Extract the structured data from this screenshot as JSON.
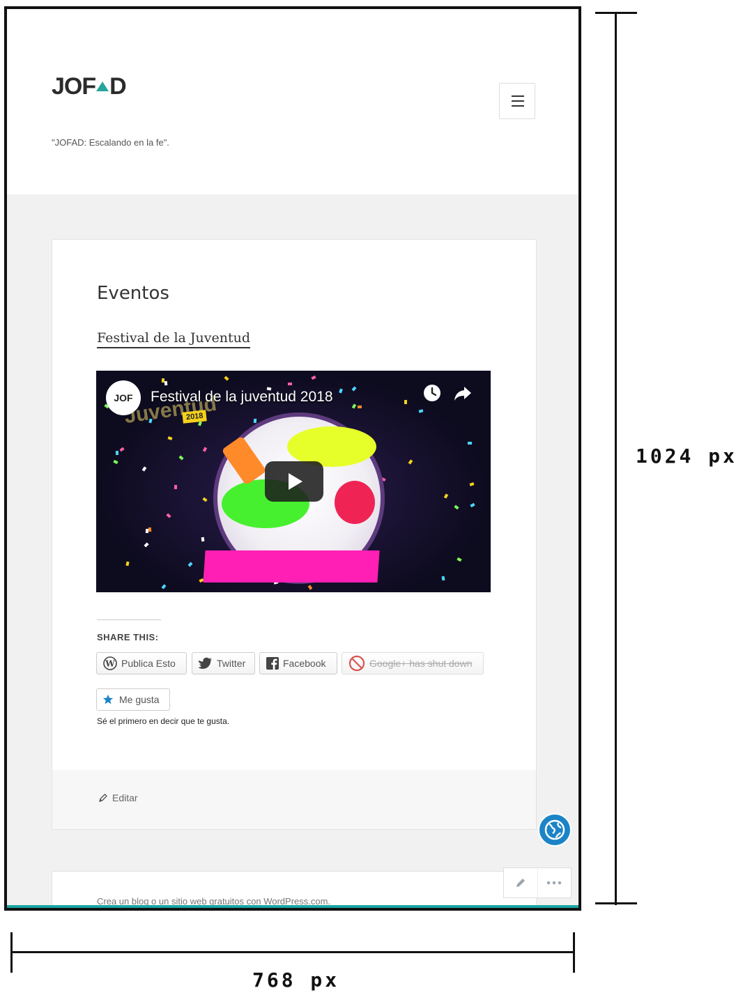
{
  "site": {
    "logo": "JOF",
    "logo_end": "D",
    "tagline": "\"JOFAD: Escalando en la fe\"."
  },
  "post": {
    "title": "Eventos",
    "link_text": "Festival de la Juventud"
  },
  "video": {
    "title": "Festival de la juventud 2018",
    "channel_avatar": "JOF",
    "overlay_text": "Juventud",
    "overlay_year": "2018"
  },
  "sharing": {
    "heading": "SHARE THIS:",
    "buttons": [
      {
        "label": "Publica Esto",
        "icon": "wordpress-icon"
      },
      {
        "label": "Twitter",
        "icon": "twitter-icon"
      },
      {
        "label": "Facebook",
        "icon": "facebook-icon"
      },
      {
        "label": "Google+ has shut down",
        "icon": "prohibited-icon"
      }
    ],
    "like_label": "Me gusta",
    "like_note": "Sé el primero en decir que te gusta."
  },
  "footer": {
    "edit_label": "Editar",
    "credit": "Crea un blog o un sitio web gratuitos con WordPress.com."
  },
  "annotations": {
    "height": "1024 px",
    "width": "768 px"
  },
  "colors": {
    "accent": "#26a59a",
    "globe": "#1c84c6",
    "play": "#1e1e1e",
    "magenta": "#ff1fb4"
  }
}
